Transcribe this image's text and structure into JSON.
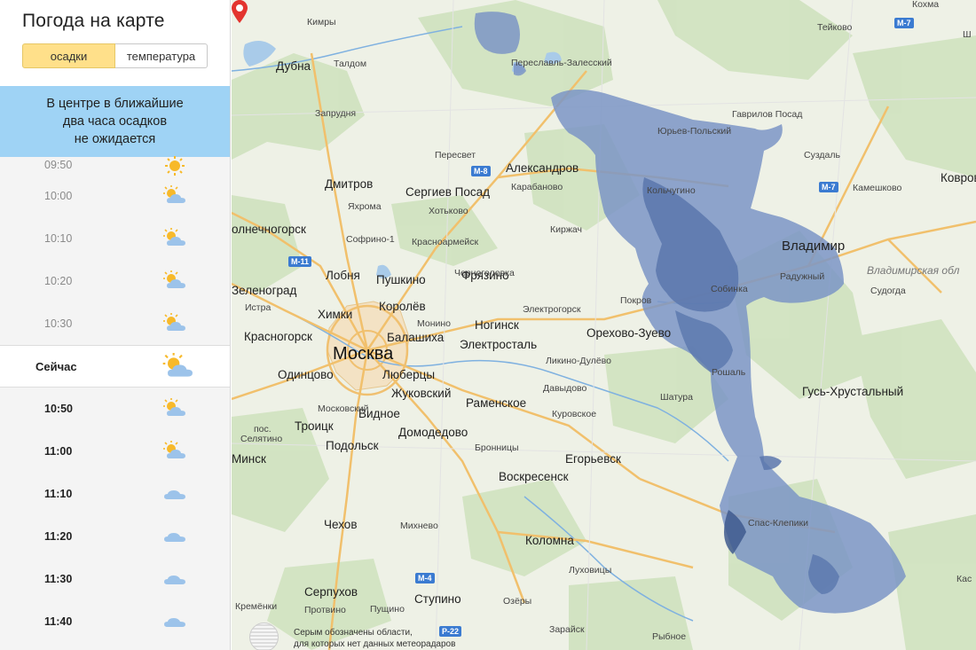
{
  "sidebar": {
    "title": "Погода на карте",
    "toggle": {
      "active": "осадки",
      "inactive": "температура"
    },
    "banner": [
      "В центре в ближайшие",
      "два часа осадков",
      "не ожидается"
    ],
    "rows": [
      {
        "time": "09:50",
        "icon": "sun-icon",
        "state": "past"
      },
      {
        "time": "10:00",
        "icon": "partly-cloudy-icon",
        "state": "past"
      },
      {
        "time": "10:10",
        "icon": "partly-cloudy-icon",
        "state": "past"
      },
      {
        "time": "10:20",
        "icon": "partly-cloudy-icon",
        "state": "past"
      },
      {
        "time": "10:30",
        "icon": "partly-cloudy-icon",
        "state": "past"
      },
      {
        "time": "Сейчас",
        "icon": "partly-cloudy-icon",
        "state": "now"
      },
      {
        "time": "10:50",
        "icon": "partly-cloudy-icon",
        "state": "future"
      },
      {
        "time": "11:00",
        "icon": "partly-cloudy-icon",
        "state": "future"
      },
      {
        "time": "11:10",
        "icon": "cloud-icon",
        "state": "future"
      },
      {
        "time": "11:20",
        "icon": "cloud-icon",
        "state": "future"
      },
      {
        "time": "11:30",
        "icon": "cloud-icon",
        "state": "future"
      },
      {
        "time": "11:40",
        "icon": "cloud-icon",
        "state": "future"
      }
    ]
  },
  "map": {
    "capital": "Москва",
    "big_cities": [
      "Владимир"
    ],
    "cities": [
      "Дмитров",
      "Сергиев Посад",
      "Александров",
      "Лобня",
      "Пушкино",
      "Зеленоград",
      "Химки",
      "Королёв",
      "Фрязино",
      "Ногинск",
      "Красногорск",
      "Балашиха",
      "Электросталь",
      "Орехово-Зуево",
      "Одинцово",
      "Люберцы",
      "Жуковский",
      "Раменское",
      "Видное",
      "Троицк",
      "Домодедово",
      "Подольск",
      "Егорьевск",
      "Воскресенск",
      "Гусь-Хрустальный",
      "Коломна",
      "Чехов",
      "Серпухов",
      "Ступино",
      "Дубна",
      "Ковров",
      "олнечногорск",
      "Минск"
    ],
    "small": [
      "Кимры",
      "Тейково",
      "Кохма",
      "Талдом",
      "Переславль-Залесский",
      "Запрудня",
      "Гаврилов Посад",
      "Юрьев-Польский",
      "Суздаль",
      "Пересвет",
      "Карабаново",
      "Камешково",
      "Кольчугино",
      "Яхрома",
      "Хотьково",
      "Киржач",
      "Софрино-1",
      "Красноармейск",
      "Радужный",
      "Судогда",
      "Черноголовка",
      "Собинка",
      "Истра",
      "Покров",
      "Электрогорск",
      "Монино",
      "Ликино-Дулёво",
      "Рошаль",
      "Давыдово",
      "Шатура",
      "Куровское",
      "Московский",
      "Бронницы",
      "Селятино",
      "Спас-Клепики",
      "Михнево",
      "Луховицы",
      "Протвино",
      "Пущино",
      "Кремёнки",
      "Озёры",
      "Зарайск",
      "Рыбное",
      "Кас",
      "Ш",
      "пос."
    ],
    "region": "Владимирская обл",
    "highways": [
      "М-7",
      "М-8",
      "М-11",
      "М-7",
      "М-4",
      "Р-22"
    ],
    "note": [
      "Серым обозначены области,",
      "для которых нет данных метеорадаров"
    ]
  }
}
